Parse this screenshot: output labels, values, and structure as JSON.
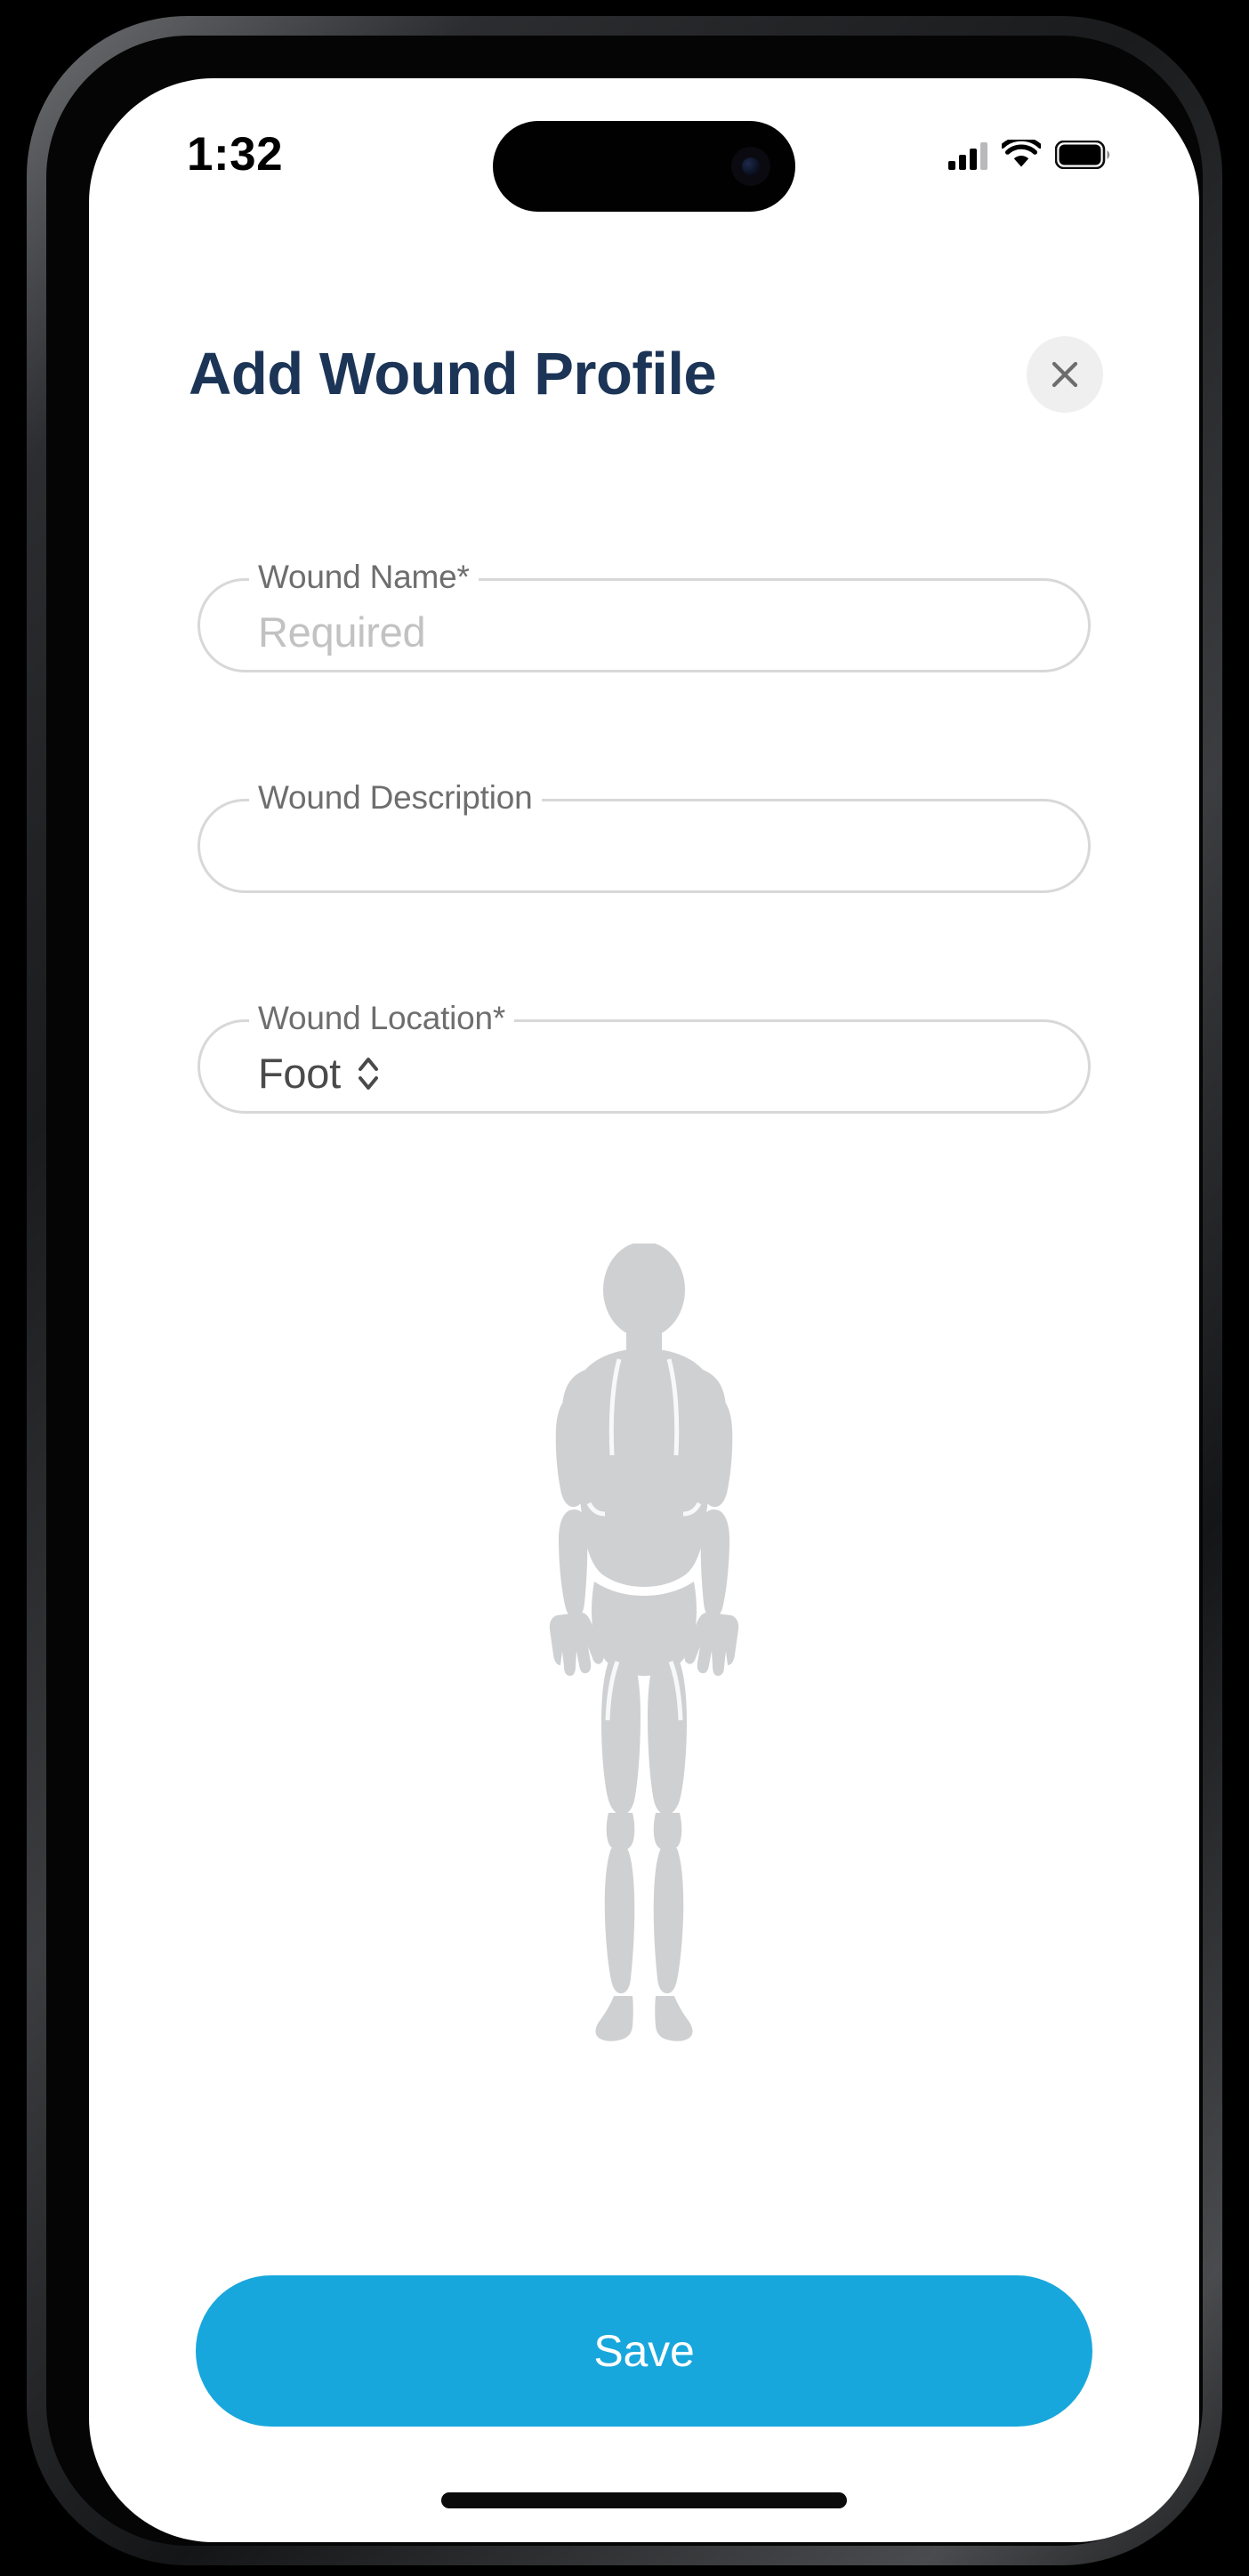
{
  "status_bar": {
    "time": "1:32",
    "cellular_icon": "cellular-bars-icon",
    "wifi_icon": "wifi-icon",
    "battery_icon": "battery-full-icon"
  },
  "header": {
    "title": "Add Wound Profile",
    "close_icon": "close-icon",
    "title_color": "#1c3557"
  },
  "form": {
    "fields": [
      {
        "label": "Wound Name*",
        "value": "",
        "placeholder": "Required",
        "type": "text",
        "required": true
      },
      {
        "label": "Wound Description",
        "value": "",
        "placeholder": "",
        "type": "text",
        "required": false
      },
      {
        "label": "Wound Location*",
        "value": "Foot",
        "placeholder": "",
        "type": "picker",
        "required": true,
        "stepper_icon": "chevron-up-down-icon"
      }
    ]
  },
  "body_diagram": {
    "name": "human-body-front-diagram",
    "fill_color": "#cfd0d2",
    "view": "front"
  },
  "footer": {
    "save_label": "Save",
    "save_color": "#17a7dc"
  },
  "home_indicator": {
    "name": "home-indicator"
  }
}
